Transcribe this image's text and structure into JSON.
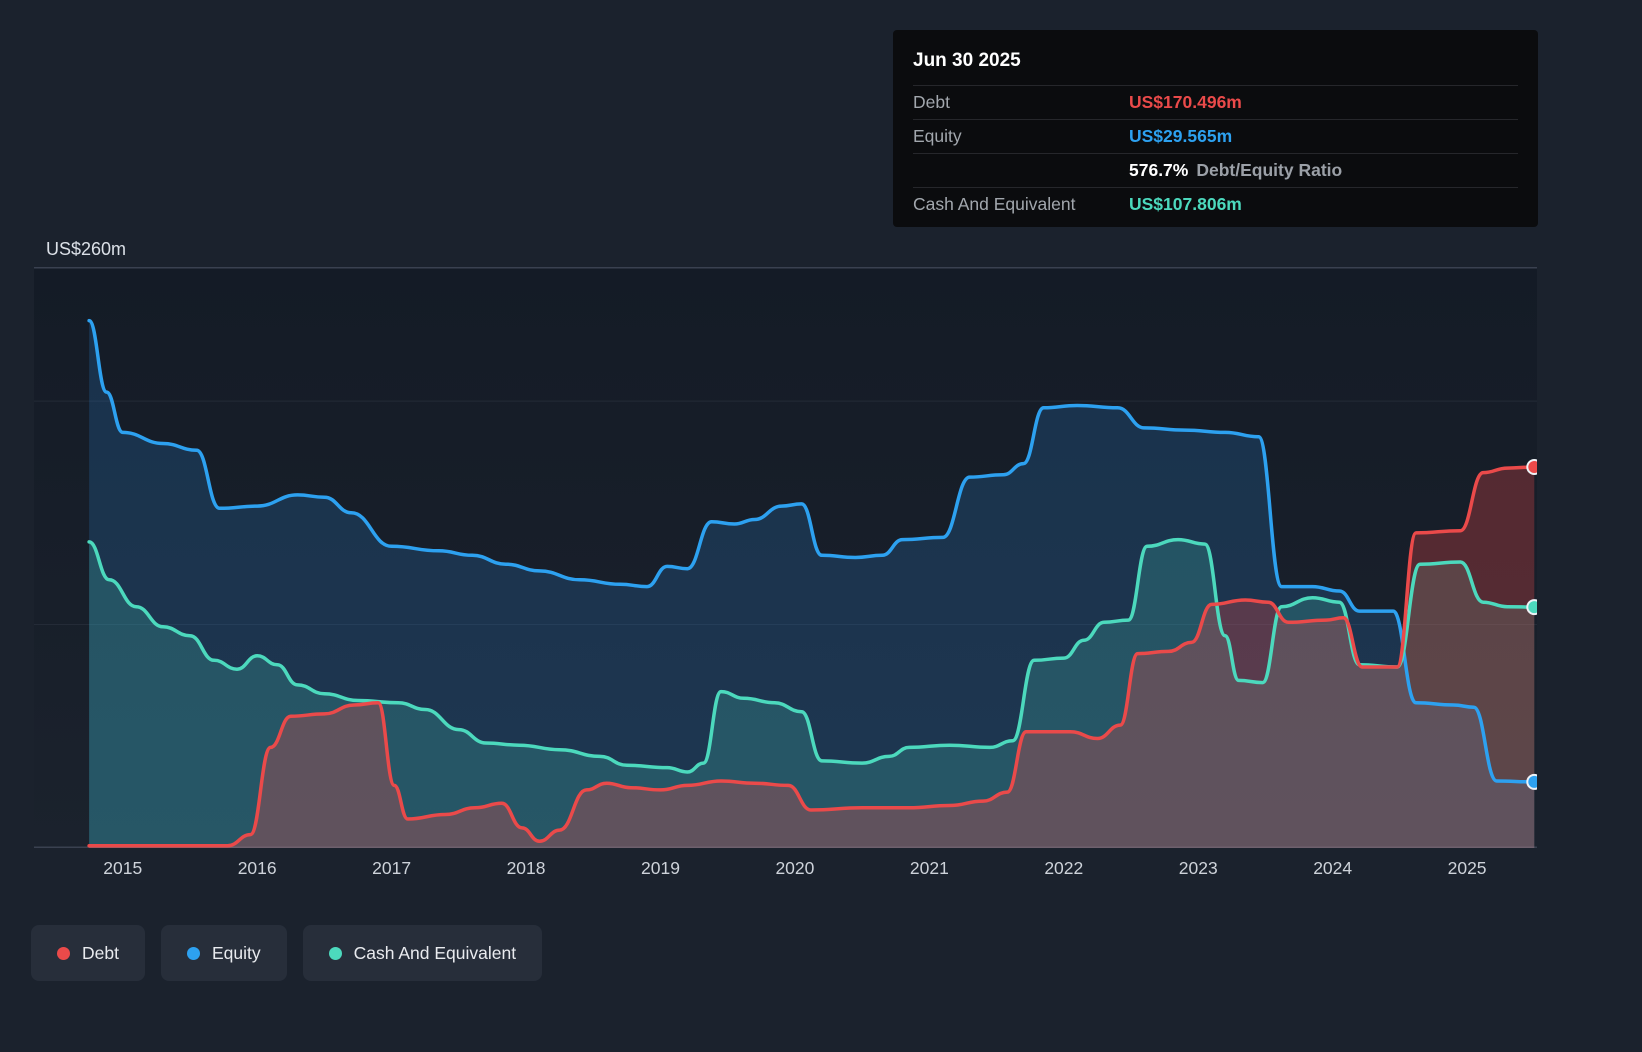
{
  "accent_colors": {
    "debt": "#ea4a4a",
    "equity": "#2da1f0",
    "cash": "#4cd9bd"
  },
  "tooltip": {
    "date": "Jun 30 2025",
    "debt_label": "Debt",
    "debt_value": "US$170.496m",
    "equity_label": "Equity",
    "equity_value": "US$29.565m",
    "ratio_value": "576.7%",
    "ratio_label": "Debt/Equity Ratio",
    "cash_label": "Cash And Equivalent",
    "cash_value": "US$107.806m"
  },
  "y_axis": {
    "top": "US$260m",
    "bottom": "US$0"
  },
  "x_axis": {
    "ticks": [
      "2015",
      "2016",
      "2017",
      "2018",
      "2019",
      "2020",
      "2021",
      "2022",
      "2023",
      "2024",
      "2025"
    ]
  },
  "legend": [
    {
      "label": "Debt",
      "color": "#ea4a4a"
    },
    {
      "label": "Equity",
      "color": "#2da1f0"
    },
    {
      "label": "Cash And Equivalent",
      "color": "#4cd9bd"
    }
  ],
  "chart_data": {
    "type": "area",
    "y_unit": "US$m",
    "x_range": [
      2014.34,
      2025.52
    ],
    "y_range": [
      0,
      260
    ],
    "gridlines": [
      100,
      200
    ],
    "series": [
      {
        "name": "Equity",
        "color": "#2da1f0",
        "fill": "rgba(45,140,225,0.20)",
        "points": [
          [
            2014.75,
            236
          ],
          [
            2014.88,
            204
          ],
          [
            2015.0,
            186
          ],
          [
            2015.3,
            181
          ],
          [
            2015.55,
            178
          ],
          [
            2015.72,
            152
          ],
          [
            2016.0,
            153
          ],
          [
            2016.3,
            158
          ],
          [
            2016.5,
            157
          ],
          [
            2016.7,
            150
          ],
          [
            2017.0,
            135
          ],
          [
            2017.35,
            133
          ],
          [
            2017.6,
            131
          ],
          [
            2017.85,
            127
          ],
          [
            2018.1,
            124
          ],
          [
            2018.4,
            120
          ],
          [
            2018.7,
            118
          ],
          [
            2018.9,
            117
          ],
          [
            2019.05,
            126
          ],
          [
            2019.2,
            125
          ],
          [
            2019.38,
            146
          ],
          [
            2019.55,
            145
          ],
          [
            2019.7,
            147
          ],
          [
            2019.9,
            153
          ],
          [
            2020.05,
            154
          ],
          [
            2020.2,
            131
          ],
          [
            2020.45,
            130
          ],
          [
            2020.65,
            131
          ],
          [
            2020.8,
            138
          ],
          [
            2021.1,
            139
          ],
          [
            2021.3,
            166
          ],
          [
            2021.55,
            167
          ],
          [
            2021.7,
            172
          ],
          [
            2021.85,
            197
          ],
          [
            2022.1,
            198
          ],
          [
            2022.4,
            197
          ],
          [
            2022.6,
            188
          ],
          [
            2022.9,
            187
          ],
          [
            2023.2,
            186
          ],
          [
            2023.45,
            184
          ],
          [
            2023.62,
            117
          ],
          [
            2023.85,
            117
          ],
          [
            2024.05,
            115
          ],
          [
            2024.2,
            106
          ],
          [
            2024.45,
            106
          ],
          [
            2024.62,
            65
          ],
          [
            2024.9,
            64
          ],
          [
            2025.05,
            63
          ],
          [
            2025.22,
            30
          ],
          [
            2025.5,
            29.565
          ]
        ]
      },
      {
        "name": "Cash And Equivalent",
        "color": "#4cd9bd",
        "fill": "rgba(76,217,189,0.20)",
        "points": [
          [
            2014.75,
            137
          ],
          [
            2014.9,
            120
          ],
          [
            2015.1,
            108
          ],
          [
            2015.3,
            99
          ],
          [
            2015.5,
            95
          ],
          [
            2015.68,
            84
          ],
          [
            2015.85,
            80
          ],
          [
            2016.0,
            86
          ],
          [
            2016.15,
            82
          ],
          [
            2016.3,
            73
          ],
          [
            2016.5,
            69
          ],
          [
            2016.75,
            66
          ],
          [
            2017.05,
            65
          ],
          [
            2017.25,
            62
          ],
          [
            2017.5,
            53
          ],
          [
            2017.7,
            47
          ],
          [
            2017.95,
            46
          ],
          [
            2018.25,
            44
          ],
          [
            2018.55,
            41
          ],
          [
            2018.75,
            37
          ],
          [
            2019.05,
            36
          ],
          [
            2019.2,
            34
          ],
          [
            2019.32,
            38
          ],
          [
            2019.45,
            70
          ],
          [
            2019.62,
            67
          ],
          [
            2019.85,
            65
          ],
          [
            2020.05,
            61
          ],
          [
            2020.2,
            39
          ],
          [
            2020.5,
            38
          ],
          [
            2020.7,
            41
          ],
          [
            2020.85,
            45
          ],
          [
            2021.15,
            46
          ],
          [
            2021.45,
            45
          ],
          [
            2021.62,
            48
          ],
          [
            2021.78,
            84
          ],
          [
            2022.0,
            85
          ],
          [
            2022.15,
            93
          ],
          [
            2022.3,
            101
          ],
          [
            2022.48,
            102
          ],
          [
            2022.62,
            135
          ],
          [
            2022.85,
            138
          ],
          [
            2023.05,
            136
          ],
          [
            2023.2,
            95
          ],
          [
            2023.3,
            75
          ],
          [
            2023.48,
            74
          ],
          [
            2023.62,
            108
          ],
          [
            2023.85,
            112
          ],
          [
            2024.05,
            110
          ],
          [
            2024.2,
            82
          ],
          [
            2024.48,
            81
          ],
          [
            2024.65,
            127
          ],
          [
            2024.95,
            128
          ],
          [
            2025.12,
            110
          ],
          [
            2025.3,
            108
          ],
          [
            2025.5,
            107.806
          ]
        ]
      },
      {
        "name": "Debt",
        "color": "#ea4a4a",
        "fill": "rgba(230,72,74,0.30)",
        "points": [
          [
            2014.75,
            1
          ],
          [
            2015.78,
            1
          ],
          [
            2015.95,
            6
          ],
          [
            2016.1,
            45
          ],
          [
            2016.25,
            59
          ],
          [
            2016.5,
            60
          ],
          [
            2016.72,
            64
          ],
          [
            2016.9,
            65
          ],
          [
            2017.02,
            28
          ],
          [
            2017.12,
            13
          ],
          [
            2017.4,
            15
          ],
          [
            2017.62,
            18
          ],
          [
            2017.82,
            20
          ],
          [
            2017.97,
            9
          ],
          [
            2018.1,
            3
          ],
          [
            2018.25,
            8
          ],
          [
            2018.45,
            26
          ],
          [
            2018.6,
            29
          ],
          [
            2018.78,
            27
          ],
          [
            2019.0,
            26
          ],
          [
            2019.2,
            28
          ],
          [
            2019.45,
            30
          ],
          [
            2019.7,
            29
          ],
          [
            2019.95,
            28
          ],
          [
            2020.12,
            17
          ],
          [
            2020.5,
            18
          ],
          [
            2020.85,
            18
          ],
          [
            2021.15,
            19
          ],
          [
            2021.4,
            21
          ],
          [
            2021.58,
            25
          ],
          [
            2021.72,
            52
          ],
          [
            2022.05,
            52
          ],
          [
            2022.25,
            49
          ],
          [
            2022.42,
            55
          ],
          [
            2022.55,
            87
          ],
          [
            2022.78,
            88
          ],
          [
            2022.95,
            92
          ],
          [
            2023.1,
            109
          ],
          [
            2023.35,
            111
          ],
          [
            2023.52,
            110
          ],
          [
            2023.67,
            101
          ],
          [
            2023.95,
            102
          ],
          [
            2024.08,
            103
          ],
          [
            2024.22,
            81
          ],
          [
            2024.48,
            81
          ],
          [
            2024.62,
            141
          ],
          [
            2024.95,
            142
          ],
          [
            2025.12,
            168
          ],
          [
            2025.3,
            170
          ],
          [
            2025.5,
            170.496
          ]
        ]
      }
    ]
  }
}
